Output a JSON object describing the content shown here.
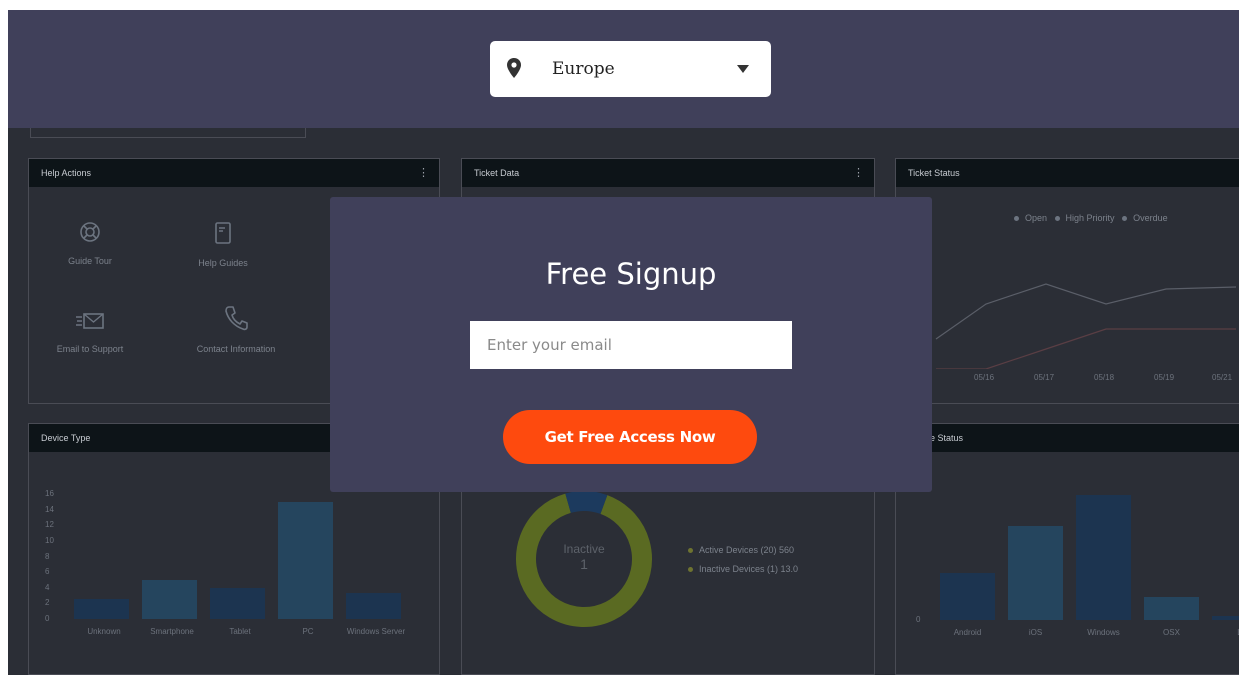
{
  "region_selector": {
    "value": "Europe"
  },
  "signup_modal": {
    "title": "Free Signup",
    "email_placeholder": "Enter your email",
    "email_value": "",
    "cta_label": "Get Free Access Now"
  },
  "dashboard": {
    "help_actions": {
      "title": "Help Actions",
      "items": [
        {
          "label": "Guide Tour",
          "icon": "lifebuoy-icon"
        },
        {
          "label": "Help Guides",
          "icon": "notebook-icon"
        },
        {
          "label": "Email to Support",
          "icon": "envelope-icon"
        },
        {
          "label": "Contact Information",
          "icon": "phone-icon"
        }
      ]
    },
    "ticket_data": {
      "title": "Ticket Data"
    },
    "ticket_status": {
      "title": "Ticket Status",
      "legend": [
        "Open",
        "High Priority",
        "Overdue"
      ],
      "x_labels": [
        "05/16",
        "05/17",
        "05/18",
        "05/19",
        "05/21"
      ]
    },
    "device_type": {
      "title": "Device Type",
      "categories": [
        "Unknown",
        "Smartphone",
        "Tablet",
        "PC",
        "Windows Server"
      ],
      "values": [
        2.5,
        5,
        4,
        15,
        3.3
      ],
      "y_ticks": [
        "16",
        "14",
        "12",
        "10",
        "8",
        "6",
        "4",
        "2",
        "0"
      ]
    },
    "device_status": {
      "center_label": "Inactive",
      "center_value": "1",
      "legend": [
        "Active Devices (20) 560",
        "Inactive Devices (1) 13.0"
      ],
      "shares": [
        0.9,
        0.1
      ]
    },
    "mobile_status": {
      "title_fragment": "e Status",
      "categories": [
        "Android",
        "iOS",
        "Windows",
        "OSX",
        "L"
      ],
      "values": [
        6,
        12,
        16,
        3,
        0.5
      ],
      "y_ticks": [
        "",
        "0"
      ]
    }
  }
}
